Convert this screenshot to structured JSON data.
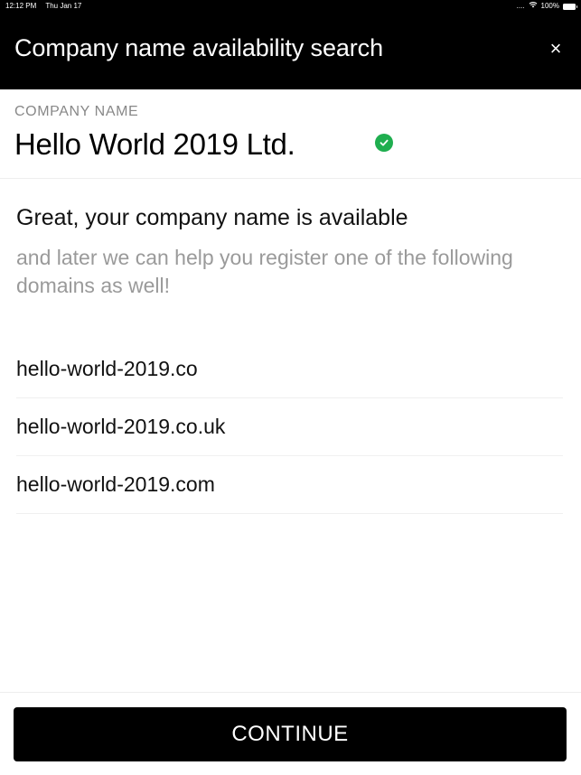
{
  "status_bar": {
    "time": "12:12 PM",
    "date": "Thu Jan 17",
    "signal": "....",
    "battery": "100%"
  },
  "header": {
    "title": "Company name availability search",
    "close_label": "×"
  },
  "company": {
    "label": "COMPANY NAME",
    "name": "Hello World 2019 Ltd.",
    "status_icon": "check-circle-icon"
  },
  "result": {
    "title": "Great, your company name is available",
    "subtitle": "and later we can help you register one of the following domains as well!"
  },
  "domains": [
    "hello-world-2019.co",
    "hello-world-2019.co.uk",
    "hello-world-2019.com"
  ],
  "footer": {
    "continue_label": "CONTINUE"
  },
  "colors": {
    "header_bg": "#000000",
    "success": "#1fae4f",
    "muted_text": "#9a9a9a"
  }
}
